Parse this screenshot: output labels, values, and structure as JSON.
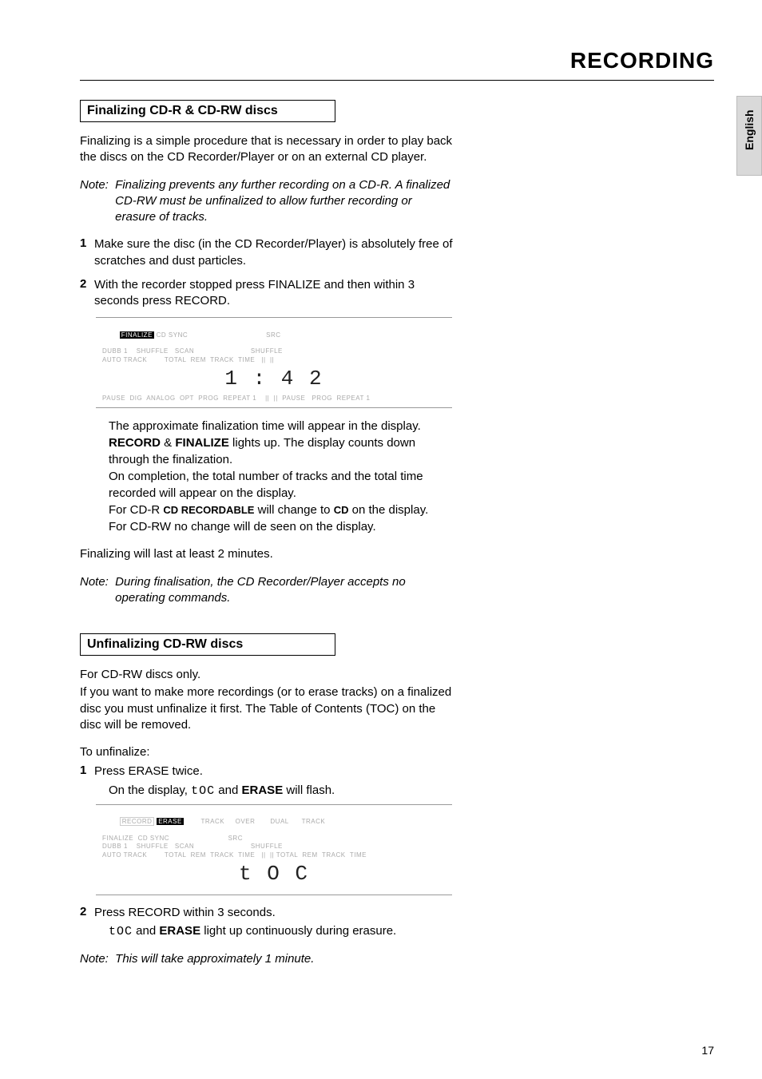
{
  "header": {
    "title": "RECORDING",
    "language_tab": "English"
  },
  "section1": {
    "title": "Finalizing CD-R & CD-RW discs",
    "intro": "Finalizing is a simple procedure that is necessary in order to play back the discs on the CD Recorder/Player or on an external CD player.",
    "note_label": "Note:",
    "note_body": "Finalizing prevents any further recording on a CD-R. A finalized CD-RW must be unfinalized to allow further recording or erasure of tracks.",
    "step1_num": "1",
    "step1": "Make sure the disc (in the CD Recorder/Player) is absolutely free of scratches and dust particles.",
    "step2_num": "2",
    "step2": "With the recorder stopped press FINALIZE and then within 3 seconds press RECORD.",
    "display1": {
      "finalize": "FINALIZE",
      "row1_rest": " CD SYNC                                    SRC",
      "row2": "DUBB 1    SHUFFLE   SCAN                          SHUFFLE",
      "row3": "AUTO TRACK        TOTAL  REM  TRACK  TIME   ||  ||",
      "time": "1 : 4 2",
      "row5": "PAUSE  DIG  ANALOG  OPT  PROG  REPEAT 1    ||  ||  PAUSE   PROG  REPEAT 1"
    },
    "after_display_1": "The approximate finalization time will appear in the display.",
    "after_display_2a": "RECORD",
    "after_display_2_amp": " & ",
    "after_display_2b": "FINALIZE",
    "after_display_2_rest": " lights up. The display counts down through the finalization.",
    "after_display_3": "On completion, the total number of tracks and the total time recorded will appear on the display.",
    "after_display_4_pre": "For CD-R ",
    "after_display_4_sc1": "CD RECORDABLE",
    "after_display_4_mid": " will change to ",
    "after_display_4_sc2": "CD",
    "after_display_4_post": " on the display.",
    "after_display_5": "For CD-RW no change will de seen on the display.",
    "closing": "Finalizing will last at least 2 minutes.",
    "note2_label": "Note:",
    "note2_body": "During finalisation, the CD Recorder/Player accepts no operating commands."
  },
  "section2": {
    "title": "Unfinalizing CD-RW discs",
    "intro1": "For CD-RW discs only.",
    "intro2": "If you want to make more recordings (or to erase tracks) on a finalized disc you must unfinalize it first. The Table of Contents (TOC) on the disc will be removed.",
    "unfinalize_label": "To unfinalize:",
    "step1_num": "1",
    "step1": "Press ERASE twice.",
    "step1_sub_pre": "On the display, ",
    "step1_sub_seg": "tOC",
    "step1_sub_mid": " and ",
    "step1_sub_b": "ERASE",
    "step1_sub_post": " will flash.",
    "display2": {
      "record": "RECORD",
      "erase": "ERASE",
      "row1_rest": "        TRACK     OVER       DUAL      TRACK",
      "row2": "FINALIZE  CD SYNC                           SRC",
      "row3": "DUBB 1    SHUFFLE   SCAN                          SHUFFLE",
      "row4": "AUTO TRACK        TOTAL  REM  TRACK  TIME   ||  || TOTAL  REM  TRACK  TIME",
      "time": "t O C"
    },
    "step2_num": "2",
    "step2": "Press RECORD within 3 seconds.",
    "step2_sub_seg": "tOC",
    "step2_sub_mid": " and ",
    "step2_sub_b": "ERASE",
    "step2_sub_post": " light up continuously during erasure.",
    "note_label": "Note:",
    "note_body": "This will take approximately 1 minute."
  },
  "page_number": "17"
}
